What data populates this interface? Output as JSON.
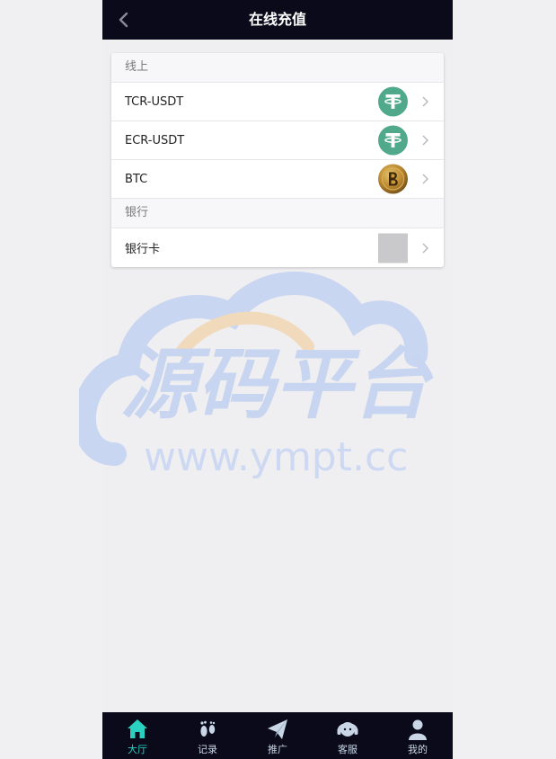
{
  "header": {
    "title": "在线充值",
    "back_icon": "chevron-left-icon"
  },
  "sections": [
    {
      "title": "线上",
      "items": [
        {
          "label": "TCR-USDT",
          "icon": "tether-icon"
        },
        {
          "label": "ECR-USDT",
          "icon": "tether-icon"
        },
        {
          "label": "BTC",
          "icon": "bitcoin-coin-icon"
        }
      ]
    },
    {
      "title": "银行",
      "items": [
        {
          "label": "银行卡",
          "icon": "bank-card-thumbnail"
        }
      ]
    }
  ],
  "watermark": {
    "text": "源码平台",
    "url": "www.ympt.cc"
  },
  "tabbar": {
    "items": [
      {
        "label": "大厅",
        "icon": "home-icon",
        "active": true
      },
      {
        "label": "记录",
        "icon": "footprint-icon",
        "active": false
      },
      {
        "label": "推广",
        "icon": "paper-plane-icon",
        "active": false
      },
      {
        "label": "客服",
        "icon": "headset-icon",
        "active": false
      },
      {
        "label": "我的",
        "icon": "user-icon",
        "active": false
      }
    ]
  },
  "colors": {
    "header_bg": "#0b0a1b",
    "tether_green": "#4fa98a",
    "active_tab": "#2ad0c0",
    "tab_label": "#c8d6e6"
  }
}
